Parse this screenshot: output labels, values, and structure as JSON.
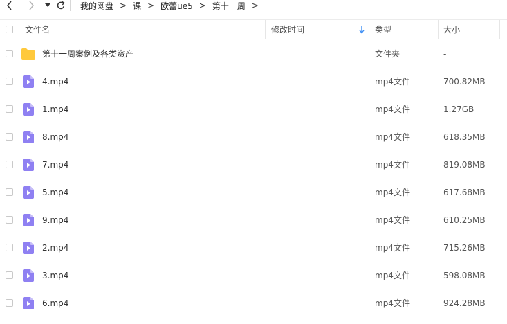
{
  "nav": {
    "back_icon": "chevron-left-icon",
    "forward_icon": "chevron-right-icon",
    "dropdown_icon": "caret-down-icon",
    "refresh_icon": "refresh-icon",
    "breadcrumb": [
      "我的网盘",
      "课",
      "欧蕾ue5",
      "第十一周"
    ],
    "separator": ">"
  },
  "table": {
    "headers": {
      "name": "文件名",
      "modified": "修改时间",
      "type": "类型",
      "size": "大小"
    },
    "sort_color": "#3b8df5",
    "rows": [
      {
        "name": "第十一周案例及各类资产",
        "type": "文件夹",
        "size": "-",
        "icon": "folder-icon"
      },
      {
        "name": "4.mp4",
        "type": "mp4文件",
        "size": "700.82MB",
        "icon": "video-file-icon"
      },
      {
        "name": "1.mp4",
        "type": "mp4文件",
        "size": "1.27GB",
        "icon": "video-file-icon"
      },
      {
        "name": "8.mp4",
        "type": "mp4文件",
        "size": "618.35MB",
        "icon": "video-file-icon"
      },
      {
        "name": "7.mp4",
        "type": "mp4文件",
        "size": "819.08MB",
        "icon": "video-file-icon"
      },
      {
        "name": "5.mp4",
        "type": "mp4文件",
        "size": "617.68MB",
        "icon": "video-file-icon"
      },
      {
        "name": "9.mp4",
        "type": "mp4文件",
        "size": "610.25MB",
        "icon": "video-file-icon"
      },
      {
        "name": "2.mp4",
        "type": "mp4文件",
        "size": "715.26MB",
        "icon": "video-file-icon"
      },
      {
        "name": "3.mp4",
        "type": "mp4文件",
        "size": "598.08MB",
        "icon": "video-file-icon"
      },
      {
        "name": "6.mp4",
        "type": "mp4文件",
        "size": "924.28MB",
        "icon": "video-file-icon"
      }
    ]
  },
  "colors": {
    "folder": "#ffc93c",
    "video": "#8f80f2"
  }
}
